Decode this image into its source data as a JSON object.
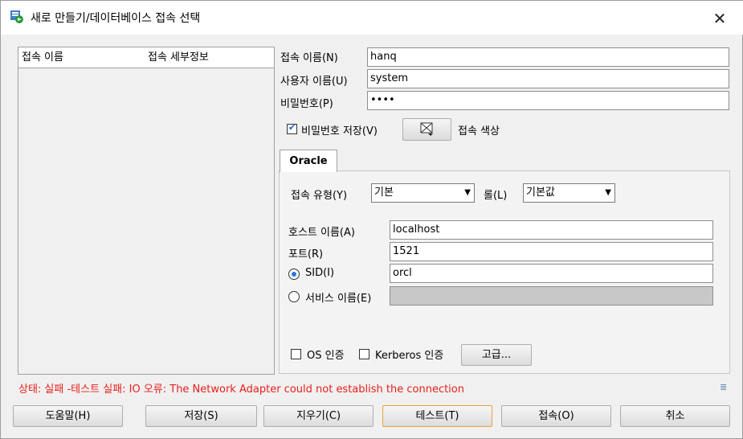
{
  "window": {
    "title": "새로 만들기/데이터베이스 접속 선택",
    "close_glyph": "✕"
  },
  "conn_list": {
    "col1": "접속 이름",
    "col2": "접속 세부정보"
  },
  "form": {
    "conn_name_label": "접속 이름(N)",
    "conn_name_value": "hanq",
    "user_label": "사용자 이름(U)",
    "user_value": "system",
    "password_label": "비밀번호(P)",
    "password_value": "••••",
    "save_password_label": "비밀번호 저장(V)",
    "save_password_checked": true,
    "conn_color_label": "접속 색상"
  },
  "tab": {
    "label": "Oracle"
  },
  "oracle": {
    "conn_type_label": "접속 유형(Y)",
    "conn_type_value": "기본",
    "role_label": "롤(L)",
    "role_value": "기본값",
    "host_label": "호스트 이름(A)",
    "host_value": "localhost",
    "port_label": "포트(R)",
    "port_value": "1521",
    "sid_label": "SID(I)",
    "sid_value": "orcl",
    "service_label": "서비스 이름(E)",
    "service_value": "",
    "os_auth_label": "OS 인증",
    "kerberos_label": "Kerberos 인증",
    "advanced_label": "고급..."
  },
  "status": "상태: 실패 -테스트 실패: IO 오류: The Network Adapter could not establish the connection",
  "buttons": {
    "help": "도움말(H)",
    "save": "저장(S)",
    "clear": "지우기(C)",
    "test": "테스트(T)",
    "connect": "접속(O)",
    "cancel": "취소"
  },
  "colors": {
    "status_error": "#e8201c",
    "focus_border": "#e8a33c"
  }
}
